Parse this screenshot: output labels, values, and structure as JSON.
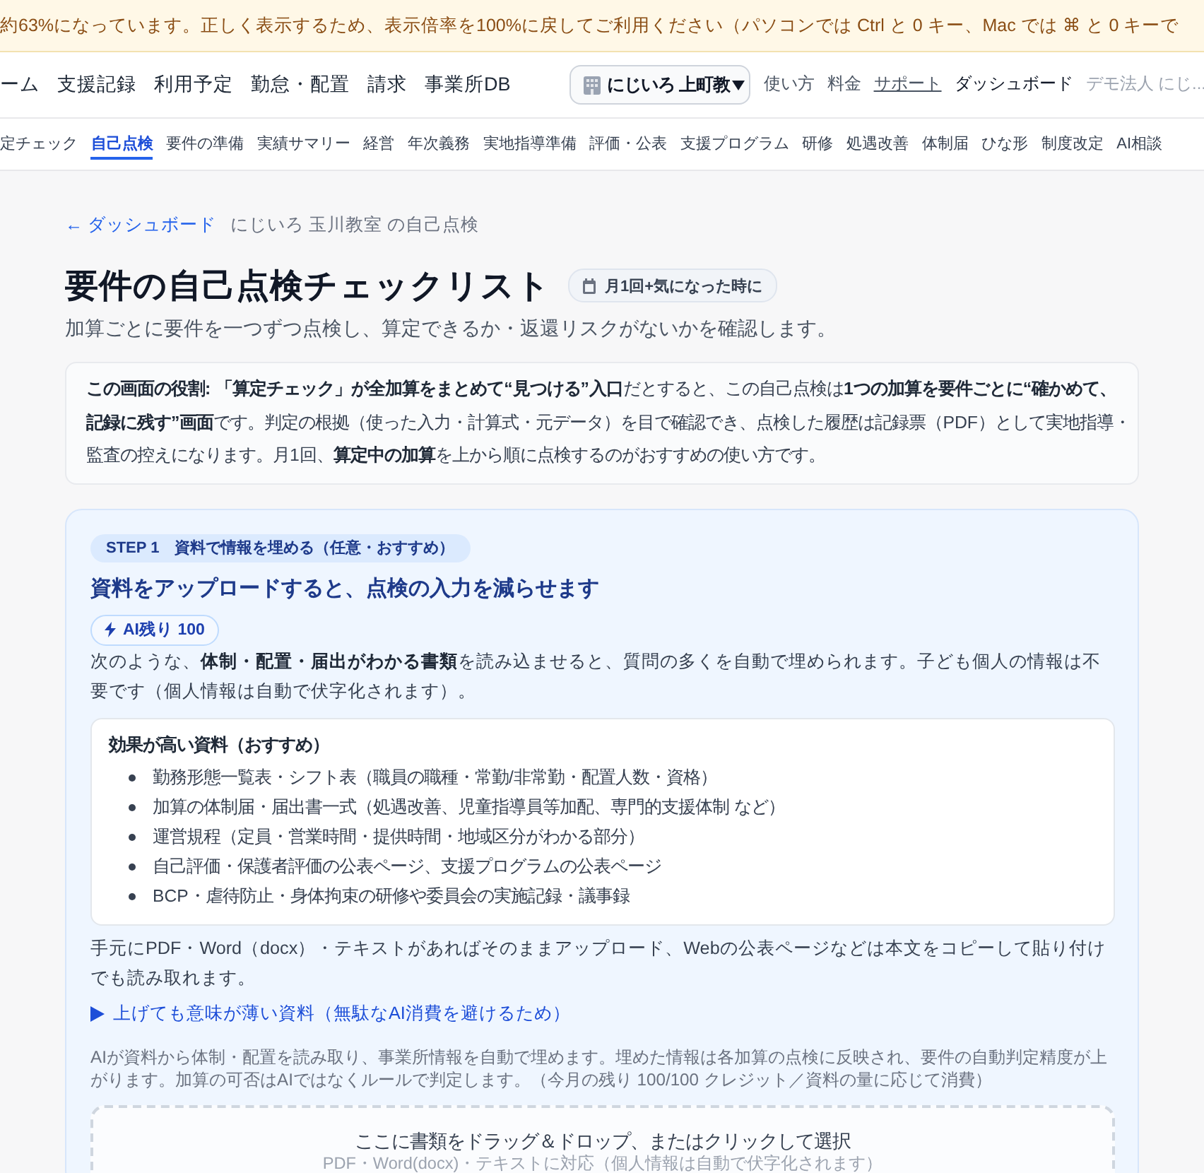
{
  "banner": {
    "text": "約63%になっています。正しく表示するため、表示倍率を100%に戻してご利用ください（パソコンでは Ctrl と 0 キー、Mac では ⌘ と 0 キーで"
  },
  "nav": {
    "items": [
      {
        "label": "ーム"
      },
      {
        "label": "支援記録"
      },
      {
        "label": "利用予定"
      },
      {
        "label": "勤怠・配置"
      },
      {
        "label": "請求"
      },
      {
        "label": "事業所DB"
      }
    ],
    "office_select": {
      "value": "にじいろ 上町教"
    },
    "links": [
      {
        "label": "使い方",
        "kind": "plain"
      },
      {
        "label": "料金",
        "kind": "plain"
      },
      {
        "label": "サポート",
        "kind": "underlined"
      },
      {
        "label": "ダッシュボード",
        "kind": "strong"
      },
      {
        "label": "デモ法人 にじ...",
        "kind": "muted"
      }
    ]
  },
  "subnav": {
    "tabs": [
      {
        "label": "定チェック",
        "selected": false
      },
      {
        "label": "自己点検",
        "selected": true
      },
      {
        "label": "要件の準備",
        "selected": false
      },
      {
        "label": "実績サマリー",
        "selected": false
      },
      {
        "label": "経営",
        "selected": false
      },
      {
        "label": "年次義務",
        "selected": false
      },
      {
        "label": "実地指導準備",
        "selected": false
      },
      {
        "label": "評価・公表",
        "selected": false
      },
      {
        "label": "支援プログラム",
        "selected": false
      },
      {
        "label": "研修",
        "selected": false
      },
      {
        "label": "処遇改善",
        "selected": false
      },
      {
        "label": "体制届",
        "selected": false
      },
      {
        "label": "ひな形",
        "selected": false
      },
      {
        "label": "制度改定",
        "selected": false
      },
      {
        "label": "AI相談",
        "selected": false
      }
    ]
  },
  "breadcrumb": {
    "back_link": "← ダッシュボード",
    "current": "にじいろ 玉川教室 の自己点検"
  },
  "header": {
    "title": "要件の自己点検チェックリスト",
    "frequency_badge": "月1回+気になった時に",
    "subtitle": "加算ごとに要件を一つずつ点検し、算定できるか・返還リスクがないかを確認します。"
  },
  "role_note": "**この画面の役割: 「算定チェック」が全加算をまとめて“見つける”入口**だとすると、この自己点検は**1つの加算を要件ごとに“確かめて、記録に残す”画面**です。判定の根拠（使った入力・計算式・元データ）を目で確認でき、点検した履歴は記録票（PDF）として実地指導・監査の控えになります。月1回、**算定中の加算**を上から順に点検するのがおすすめの使い方です。",
  "step": {
    "badge": "STEP 1　資料で情報を埋める（任意・おすすめ）",
    "heading": "資料をアップロードすると、点検の入力を減らせます",
    "ai_credit": "AI残り 100",
    "intro": "次のような、**体制・配置・届出がわかる書類**を読み込ませると、質問の多くを自動で埋められます。子ども個人の情報は不要です（個人情報は自動で伏字化されます）。",
    "recommended": {
      "title": "効果が高い資料（おすすめ）",
      "items": [
        "勤務形態一覧表・シフト表（職員の職種・常勤/非常勤・配置人数・資格）",
        "加算の体制届・届出書一式（処遇改善、児童指導員等加配、専門的支援体制 など）",
        "運営規程（定員・営業時間・提供時間・地域区分がわかる部分）",
        "自己評価・保護者評価の公表ページ、支援プログラムの公表ページ",
        "BCP・虐待防止・身体拘束の研修や委員会の実施記録・議事録"
      ]
    },
    "note": "手元にPDF・Word（docx）・テキストがあればそのままアップロード、Webの公表ページなどは本文をコピーして貼り付けでも読み取れます。",
    "disclosure": {
      "label": "上げても意味が薄い資料（無駄なAI消費を避けるため）",
      "expanded": false
    },
    "ai_note": "AIが資料から体制・配置を読み取り、事業所情報を自動で埋めます。埋めた情報は各加算の点検に反映され、要件の自動判定精度が上がります。加算の可否はAIではなくルールで判定します。（今月の残り 100/100 クレジット／資料の量に応じて消費）",
    "dropzone": {
      "title": "ここに書類をドラッグ＆ドロップ、またはクリックして選択",
      "hint": "PDF・Word(docx)・テキストに対応（個人情報は自動で伏字化されます）"
    }
  }
}
